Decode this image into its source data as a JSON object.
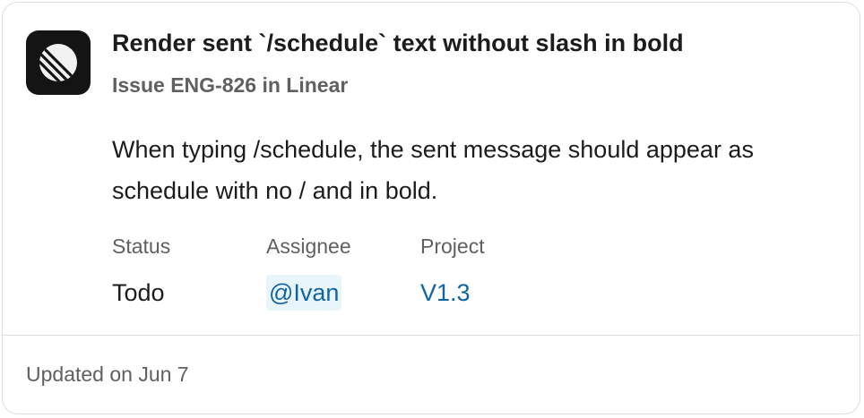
{
  "app": {
    "icon": "linear-logo-icon",
    "logo_bg_color": "#141414"
  },
  "issue": {
    "title": "Render sent `/schedule` text without slash in bold",
    "subtitle": "Issue ENG-826 in Linear",
    "description": "When typing /schedule, the sent message should appear as schedule with no / and in bold."
  },
  "fields": {
    "status": {
      "label": "Status",
      "value": "Todo"
    },
    "assignee": {
      "label": "Assignee",
      "value": "@Ivan"
    },
    "project": {
      "label": "Project",
      "value": "V1.3"
    }
  },
  "footer": {
    "updated": "Updated on Jun 7"
  },
  "colors": {
    "link": "#1264a3",
    "mention_bg": "#e8f5fa",
    "text": "#1d1c1d",
    "muted": "#616061",
    "border": "#dedede"
  }
}
